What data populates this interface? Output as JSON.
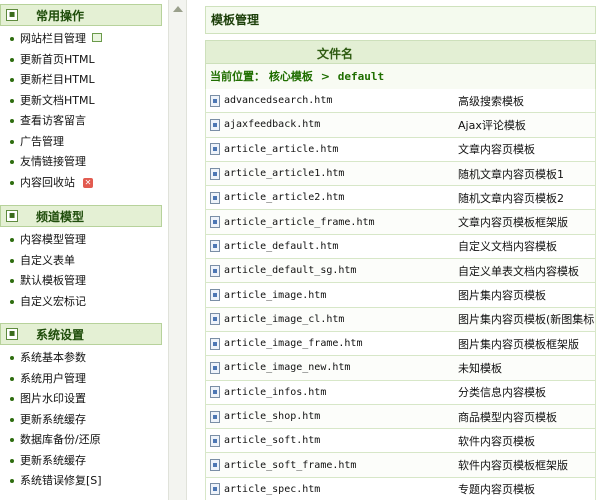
{
  "sidebar": {
    "groups": [
      {
        "title": "常用操作",
        "items": [
          "网站栏目管理",
          "更新首页HTML",
          "更新栏目HTML",
          "更新文档HTML",
          "查看访客留言",
          "广告管理",
          "友情链接管理",
          "内容回收站"
        ]
      },
      {
        "title": "频道模型",
        "items": [
          "内容模型管理",
          "自定义表单",
          "默认模板管理",
          "自定义宏标记"
        ]
      },
      {
        "title": "系统设置",
        "items": [
          "系统基本参数",
          "系统用户管理",
          "图片水印设置",
          "更新系统缓存",
          "数据库备份/还原",
          "更新系统缓存",
          "系统错误修复[S]"
        ]
      }
    ]
  },
  "main": {
    "title": "模板管理",
    "column_header": "文件名",
    "path_label": "当前位置：",
    "path_folder": "核心模板",
    "path_sep": ">",
    "path_current": "default",
    "rows": [
      {
        "file": "advancedsearch.htm",
        "desc": "高级搜索模板"
      },
      {
        "file": "ajaxfeedback.htm",
        "desc": "Ajax评论模板"
      },
      {
        "file": "article_article.htm",
        "desc": "文章内容页模板"
      },
      {
        "file": "article_article1.htm",
        "desc": "随机文章内容页模板1"
      },
      {
        "file": "article_article2.htm",
        "desc": "随机文章内容页模板2"
      },
      {
        "file": "article_article_frame.htm",
        "desc": "文章内容页模板框架版"
      },
      {
        "file": "article_default.htm",
        "desc": "自定义文档内容模板"
      },
      {
        "file": "article_default_sg.htm",
        "desc": "自定义单表文档内容模板"
      },
      {
        "file": "article_image.htm",
        "desc": "图片集内容页模板"
      },
      {
        "file": "article_image_cl.htm",
        "desc": "图片集内容页模板(新图集标"
      },
      {
        "file": "article_image_frame.htm",
        "desc": "图片集内容页模板框架版"
      },
      {
        "file": "article_image_new.htm",
        "desc": "未知模板"
      },
      {
        "file": "article_infos.htm",
        "desc": "分类信息内容模板"
      },
      {
        "file": "article_shop.htm",
        "desc": "商品模型内容页模板"
      },
      {
        "file": "article_soft.htm",
        "desc": "软件内容页模板"
      },
      {
        "file": "article_soft_frame.htm",
        "desc": "软件内容页模板框架版"
      },
      {
        "file": "article_spec.htm",
        "desc": "专题内容页模板"
      }
    ]
  },
  "colors": {
    "group_header_bg": "#e4f0d4",
    "group_header_border": "#b7d29b",
    "accent_green": "#1f6e00",
    "row_border": "#d7e7c8"
  },
  "icons": {
    "group_toggle": "plus-box-icon",
    "file": "file-icon",
    "recycle": "recycle-x-icon",
    "new_page": "page-add-icon"
  }
}
